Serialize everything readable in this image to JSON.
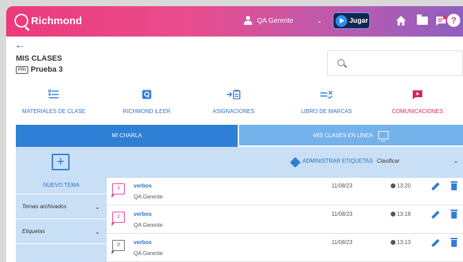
{
  "header": {
    "brand": "Richmond",
    "user_name": "QA Gerente",
    "caret": "⌄",
    "play_label": "Jugar",
    "help": "?"
  },
  "page": {
    "back": "←",
    "title": "MIS CLASES",
    "level_badge": "PRI",
    "class_name": "Prueba 3",
    "search_placeholder": ""
  },
  "nav": [
    {
      "label": "MATERIALES DE CLASE",
      "icon": "materials-icon"
    },
    {
      "label": "RICHMOND iLEER",
      "icon": "ileer-icon"
    },
    {
      "label": "ASIGNACIONES",
      "icon": "assignments-icon"
    },
    {
      "label": "LIBRO DE MARCAS",
      "icon": "gradebook-icon"
    },
    {
      "label": "COMUNICACIONES",
      "icon": "communications-icon"
    }
  ],
  "tabs": {
    "mi_charla": "MI CHARLA",
    "mis_clases_en_linea": "MIS CLASES EN LÍNEA"
  },
  "sidebar": {
    "new_topic": "NUEVO TEMA",
    "new_topic_icon": "+",
    "archived": "Temas archivados",
    "tags": "Etiquetas",
    "chevron": "⌄"
  },
  "list_header": {
    "admin_tags": "ADMINISTRAR ETIQUETAS",
    "sort": "Clasificar",
    "chevron": "⌄"
  },
  "threads": [
    {
      "count": "3",
      "title": "verbos",
      "author": "QA Gerente",
      "date": "11/08/23",
      "time": "13:20"
    },
    {
      "count": "2",
      "title": "verbos",
      "author": "QA Gerente",
      "date": "11/08/23",
      "time": "13:18"
    },
    {
      "count": "0",
      "title": "verbos",
      "author": "QA Gerente",
      "date": "11/08/23",
      "time": "13:13"
    }
  ],
  "colors": {
    "accent": "#2e7fd6",
    "pink": "#e23a8e",
    "communications": "#d6275f"
  }
}
